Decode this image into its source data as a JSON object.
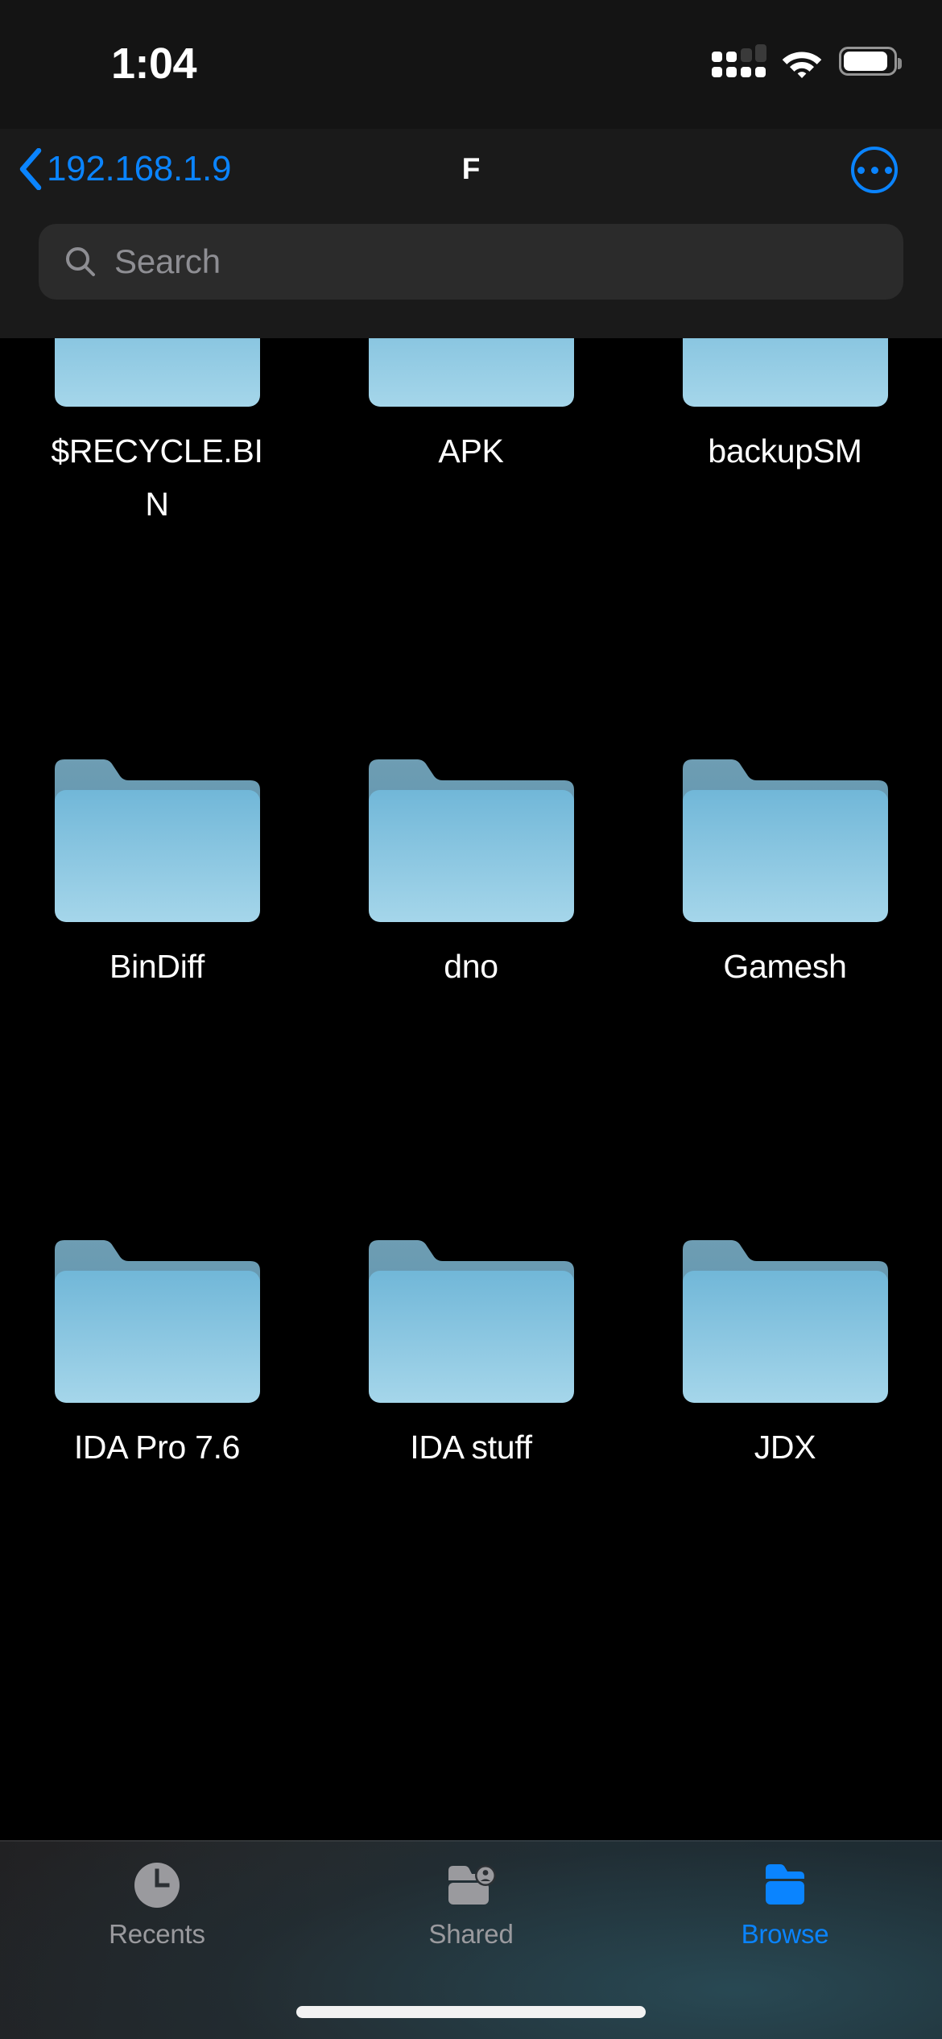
{
  "status_bar": {
    "time": "1:04",
    "cellular_icon": "cellular-signal-icon",
    "wifi_icon": "wifi-icon",
    "battery_icon": "battery-icon",
    "battery_level_percent": 85
  },
  "nav_bar": {
    "back_label": "192.168.1.9",
    "back_icon": "chevron-left-icon",
    "title": "F",
    "more_icon": "ellipsis-circle-icon"
  },
  "search": {
    "placeholder": "Search",
    "value": "",
    "icon": "search-icon"
  },
  "grid": {
    "icon_type": "folder-icon",
    "rows": [
      [
        {
          "name": "$RECYCLE.BIN"
        },
        {
          "name": "APK"
        },
        {
          "name": "backupSM"
        }
      ],
      [
        {
          "name": "BinDiff"
        },
        {
          "name": "dno"
        },
        {
          "name": "Gamesh"
        }
      ],
      [
        {
          "name": "IDA Pro 7.6"
        },
        {
          "name": "IDA stuff"
        },
        {
          "name": "JDX"
        }
      ]
    ]
  },
  "tab_bar": {
    "items": [
      {
        "label": "Recents",
        "icon": "clock-icon",
        "active": false
      },
      {
        "label": "Shared",
        "icon": "shared-folder-person-icon",
        "active": false
      },
      {
        "label": "Browse",
        "icon": "folder-icon",
        "active": true
      }
    ]
  },
  "colors": {
    "accent": "#0a84ff",
    "background": "#000000",
    "header_background": "#1a1a1a",
    "search_background": "#2b2b2b",
    "folder_front": "#7cc0dc",
    "folder_back": "#5b93ad",
    "label_text": "#ffffff",
    "inactive_tab": "#9a9a9e"
  }
}
